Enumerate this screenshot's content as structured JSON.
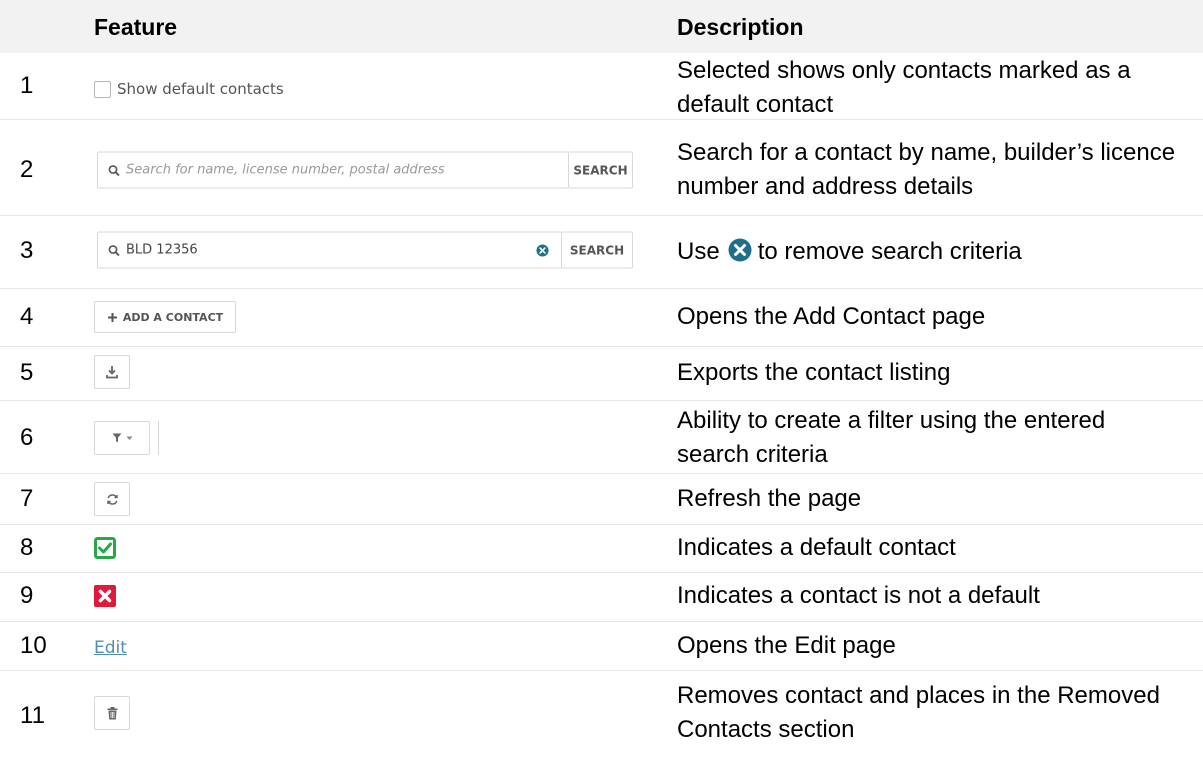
{
  "header": {
    "feature": "Feature",
    "description": "Description"
  },
  "rows": [
    {
      "num": "1",
      "description": "Selected shows only contacts marked as a default contact",
      "checkbox_label": "Show default contacts",
      "icon": "checkbox-icon"
    },
    {
      "num": "2",
      "description": "Search for a contact by name, builder’s licence number and address details",
      "placeholder": "Search for name, license number, postal address",
      "button": "SEARCH",
      "icon": "search-icon"
    },
    {
      "num": "3",
      "description_before": "Use",
      "description_after": "to remove search criteria",
      "value": "BLD 12356",
      "button": "SEARCH",
      "icon": "clear-icon"
    },
    {
      "num": "4",
      "description": "Opens the Add Contact page",
      "button": "ADD A CONTACT",
      "icon": "plus-icon"
    },
    {
      "num": "5",
      "description": "Exports the contact listing",
      "icon": "download-icon"
    },
    {
      "num": "6",
      "description": "Ability to create a filter using the entered search criteria",
      "icon": "filter-icon"
    },
    {
      "num": "7",
      "description": "Refresh the page",
      "icon": "refresh-icon"
    },
    {
      "num": "8",
      "description": "Indicates a default contact",
      "icon": "check-icon",
      "color": "#27a844"
    },
    {
      "num": "9",
      "description": "Indicates a contact is not a default",
      "icon": "x-icon",
      "color": "#e0193a"
    },
    {
      "num": "10",
      "description": "Opens the Edit page",
      "link": "Edit"
    },
    {
      "num": "11",
      "description": "Removes contact and places in the Removed Contacts section",
      "icon": "trash-icon"
    }
  ],
  "colors": {
    "header_bg": "#f2f2f2",
    "link": "#4f8fb3",
    "clear_icon": "#1f6f8b"
  }
}
